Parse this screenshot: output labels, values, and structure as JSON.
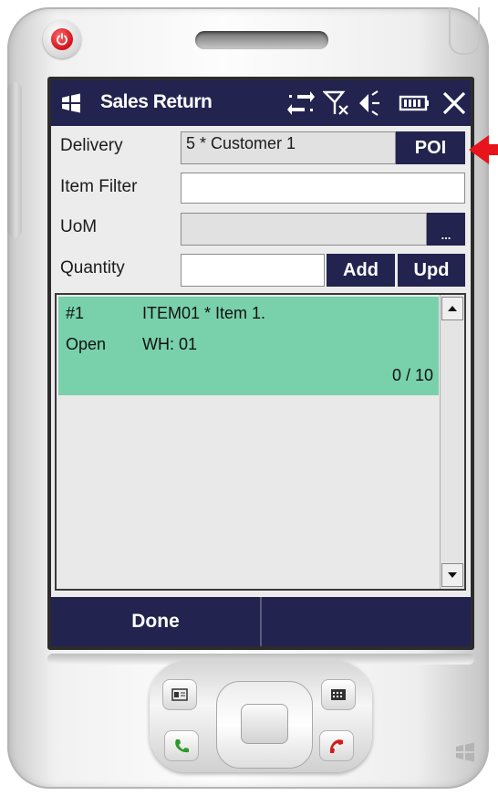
{
  "window": {
    "title": "Sales Return"
  },
  "status_icons": [
    "sync-arrows-icon",
    "no-signal-icon",
    "volume-icon",
    "battery-icon",
    "close-icon"
  ],
  "form": {
    "delivery": {
      "label": "Delivery",
      "value": "5 * Customer 1",
      "button": "POI"
    },
    "item_filter": {
      "label": "Item Filter",
      "value": ""
    },
    "uom": {
      "label": "UoM",
      "value": "",
      "button": "..."
    },
    "quantity": {
      "label": "Quantity",
      "value": "",
      "add_button": "Add",
      "upd_button": "Upd"
    }
  },
  "items": [
    {
      "number": "#1",
      "code": "ITEM01 * Item 1.",
      "status": "Open",
      "warehouse": "WH: 01",
      "progress": "0 / 10"
    }
  ],
  "bottom_bar": {
    "left": "Done",
    "right": ""
  },
  "colors": {
    "title_bar": "#23234f",
    "selected_row": "#79d1ab",
    "callout_arrow": "#e8141b"
  }
}
